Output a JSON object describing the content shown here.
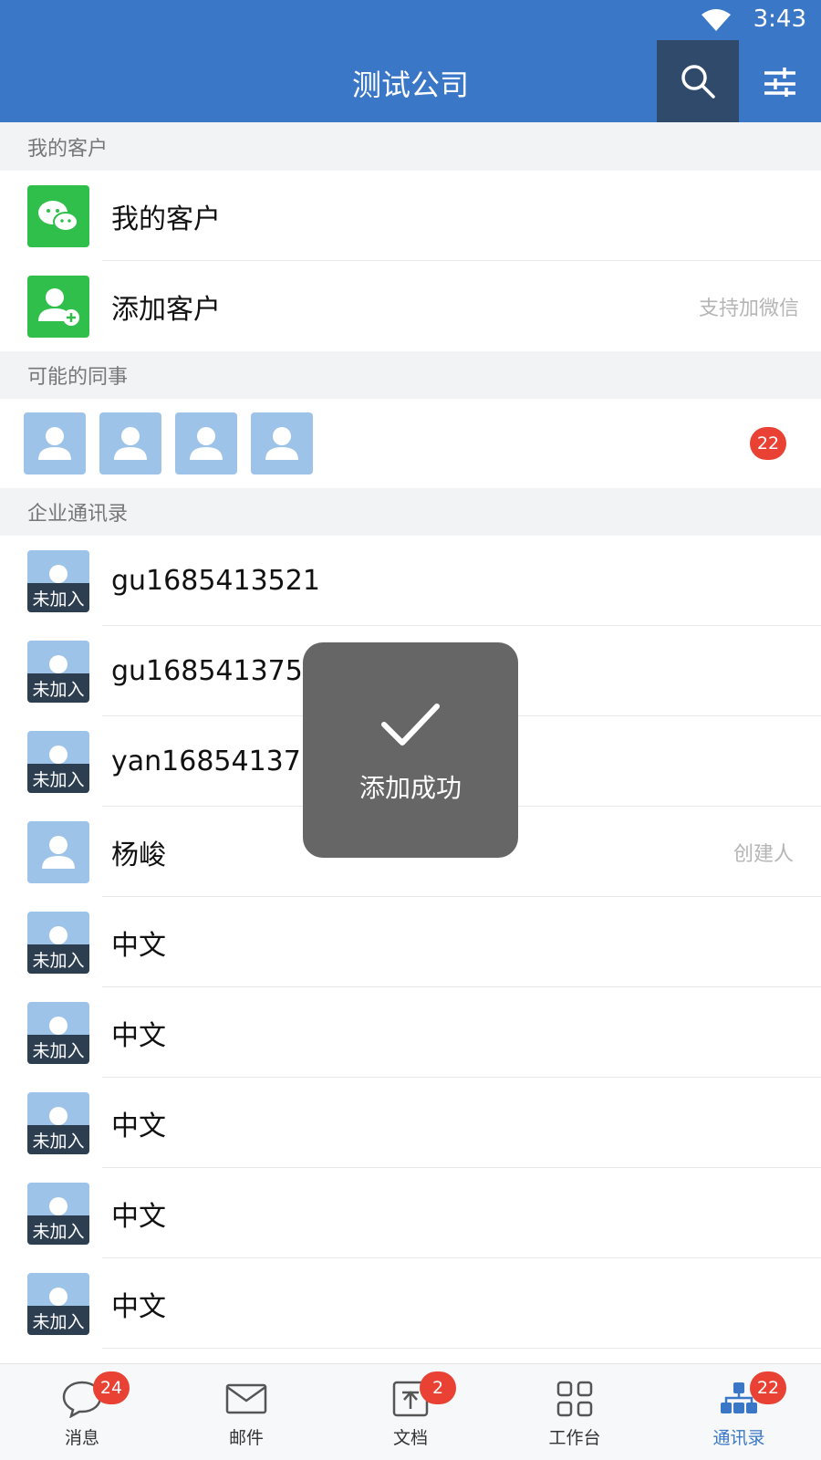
{
  "status": {
    "time": "3:43"
  },
  "header": {
    "title": "测试公司"
  },
  "sections": {
    "my_customers": "我的客户",
    "possible_colleagues": "可能的同事",
    "directory": "企业通讯录"
  },
  "customers": {
    "my_customers_label": "我的客户",
    "add_customer_label": "添加客户",
    "add_customer_hint": "支持加微信"
  },
  "colleagues": {
    "count_badge": "22"
  },
  "not_joined_label": "未加入",
  "contacts": [
    {
      "name": "gu1685413521"
    },
    {
      "name": "gu1685413752"
    },
    {
      "name": "yan1685413761"
    },
    {
      "name": "杨峻",
      "tag": "创建人"
    },
    {
      "name": "中文"
    },
    {
      "name": "中文"
    },
    {
      "name": "中文"
    },
    {
      "name": "中文"
    },
    {
      "name": "中文"
    }
  ],
  "toast": {
    "text": "添加成功"
  },
  "bottom_nav": {
    "messages": {
      "label": "消息",
      "badge": "24"
    },
    "mail": {
      "label": "邮件"
    },
    "docs": {
      "label": "文档",
      "badge": "2"
    },
    "workbench": {
      "label": "工作台"
    },
    "contacts": {
      "label": "通讯录",
      "badge": "22"
    }
  },
  "colors": {
    "primary": "#3a77c6",
    "badge": "#e94234",
    "green": "#2fbf4a"
  }
}
